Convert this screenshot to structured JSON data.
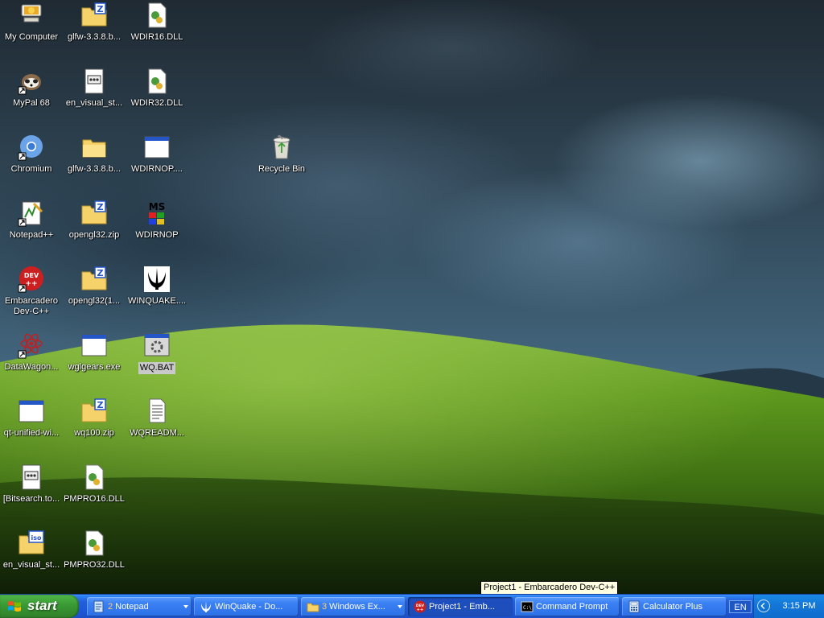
{
  "desktop": {
    "icons": [
      {
        "label": "My Computer",
        "icon": "computer-icon"
      },
      {
        "label": "MyPal 68",
        "icon": "mypal-icon"
      },
      {
        "label": "Chromium",
        "icon": "chromium-icon"
      },
      {
        "label": "Notepad++",
        "icon": "notepad-plus-icon"
      },
      {
        "label": "Embarcadero Dev-C++",
        "label_line1": "Embarcadero",
        "label_line2": "Dev-C++",
        "icon": "devcpp-icon"
      },
      {
        "label": "DataWagon...",
        "icon": "atom-icon"
      },
      {
        "label": "qt-unified-wi...",
        "icon": "window-icon"
      },
      {
        "label": "[Bitsearch.to...",
        "icon": "text-file-icon"
      },
      {
        "label": "en_visual_st...",
        "icon": "iso-icon"
      },
      {
        "label": "glfw-3.3.8.b...",
        "icon": "zip-folder-icon"
      },
      {
        "label": "en_visual_st...",
        "icon": "text-file-icon"
      },
      {
        "label": "glfw-3.3.8.b...",
        "icon": "folder-icon"
      },
      {
        "label": "opengl32.zip",
        "icon": "zip-folder-icon"
      },
      {
        "label": "opengl32(1...",
        "icon": "zip-folder-icon"
      },
      {
        "label": "wglgears.exe",
        "icon": "window-icon"
      },
      {
        "label": "wq100.zip",
        "icon": "zip-folder-icon"
      },
      {
        "label": "PMPRO16.DLL",
        "icon": "dll-icon"
      },
      {
        "label": "PMPRO32.DLL",
        "icon": "dll-icon"
      },
      {
        "label": "WDIR16.DLL",
        "icon": "dll-icon"
      },
      {
        "label": "WDIR32.DLL",
        "icon": "dll-icon"
      },
      {
        "label": "WDIRNOP....",
        "icon": "window-icon"
      },
      {
        "label": "WDIRNOP",
        "icon": "ms-dos-icon",
        "glyph_text": "MS"
      },
      {
        "label": "WINQUAKE....",
        "icon": "quake-icon"
      },
      {
        "label": "WQ.BAT",
        "icon": "batch-icon",
        "selected": true
      },
      {
        "label": "WQREADM...",
        "icon": "document-icon"
      },
      {
        "label": "Recycle Bin",
        "icon": "recycle-bin-icon"
      }
    ]
  },
  "tooltip": {
    "text": "Project1 - Embarcadero Dev-C++"
  },
  "taskbar": {
    "start_label": "start",
    "buttons": [
      {
        "label": "Notepad",
        "count": "2",
        "icon": "notepad-icon",
        "has_caret": true
      },
      {
        "label": "WinQuake - Do...",
        "icon": "quake-icon"
      },
      {
        "label": "Windows Ex...",
        "count": "3",
        "icon": "folder-icon",
        "has_caret": true
      },
      {
        "label": "Project1 - Emb...",
        "icon": "devcpp-icon",
        "active": true
      },
      {
        "label": "Command Prompt",
        "icon": "cmd-icon",
        "glyph_text": "C:\\"
      },
      {
        "label": "Calculator Plus",
        "icon": "calculator-icon"
      }
    ],
    "language": "EN",
    "clock": "3:15 PM"
  },
  "colors": {
    "taskbar_blue": "#245edb",
    "start_green": "#3c9c36",
    "tooltip_bg": "#ffffe1",
    "grass_green": "#5f9a1e"
  }
}
